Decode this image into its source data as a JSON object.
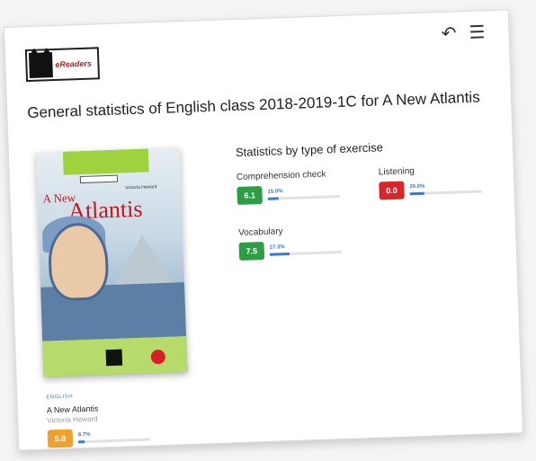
{
  "header": {
    "logo_text": "eReaders",
    "back_icon": "undo-icon",
    "menu_icon": "hamburger-menu-icon"
  },
  "page": {
    "title": "General statistics of English class 2018-2019-1C for A New Atlantis"
  },
  "book": {
    "cover_title_line1": "A New",
    "cover_title_line2": "Atlantis",
    "cover_author": "Victoria Heward",
    "language": "ENGLISH",
    "title": "A New Atlantis",
    "author": "Victoria Heward",
    "score": "5.8",
    "percent": "8.7%",
    "percent_value": 8.7,
    "score_color": "#f0a030"
  },
  "stats": {
    "title": "Statistics by type of exercise",
    "items": [
      {
        "label": "Comprehension check",
        "score": "6.1",
        "percent": "15.0%",
        "percent_value": 15.0,
        "color": "#2e9e46"
      },
      {
        "label": "Listening",
        "score": "0.0",
        "percent": "20.0%",
        "percent_value": 20.0,
        "color": "#d6272c"
      },
      {
        "label": "Vocabulary",
        "score": "7.5",
        "percent": "27.3%",
        "percent_value": 27.3,
        "color": "#2e9e46"
      }
    ]
  }
}
